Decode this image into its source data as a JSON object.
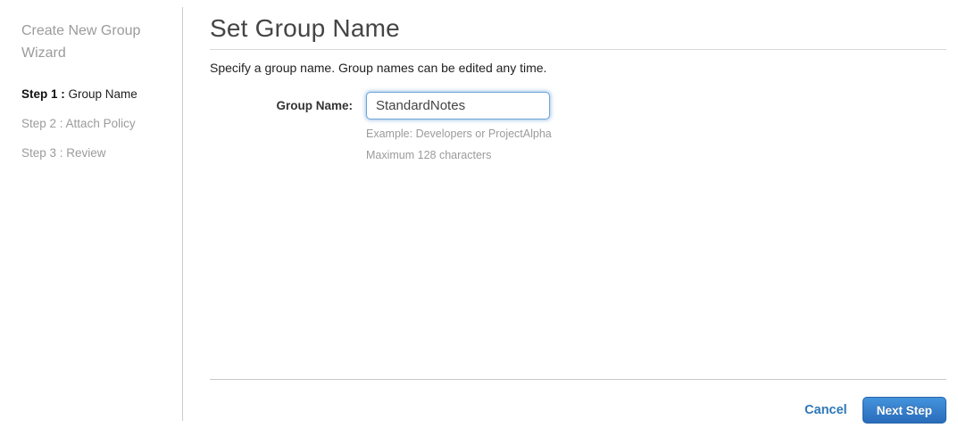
{
  "sidebar": {
    "title": "Create New Group Wizard",
    "steps": [
      {
        "prefix": "Step 1 :",
        "label": " Group Name"
      },
      {
        "prefix": "Step 2 :",
        "label": " Attach Policy"
      },
      {
        "prefix": "Step 3 :",
        "label": " Review"
      }
    ]
  },
  "main": {
    "title": "Set Group Name",
    "description": "Specify a group name. Group names can be edited any time.",
    "form": {
      "group_name_label": "Group Name:",
      "group_name_value": "StandardNotes",
      "hint_example": "Example: Developers or ProjectAlpha",
      "hint_max": "Maximum 128 characters"
    },
    "footer": {
      "cancel_label": "Cancel",
      "next_label": "Next Step"
    }
  },
  "colors": {
    "accent_blue": "#2e77b8",
    "button_gradient_top": "#4393dd",
    "button_gradient_bottom": "#2a6cbb",
    "muted_text": "#9b9b9b",
    "focus_border": "#6fa5d8"
  }
}
